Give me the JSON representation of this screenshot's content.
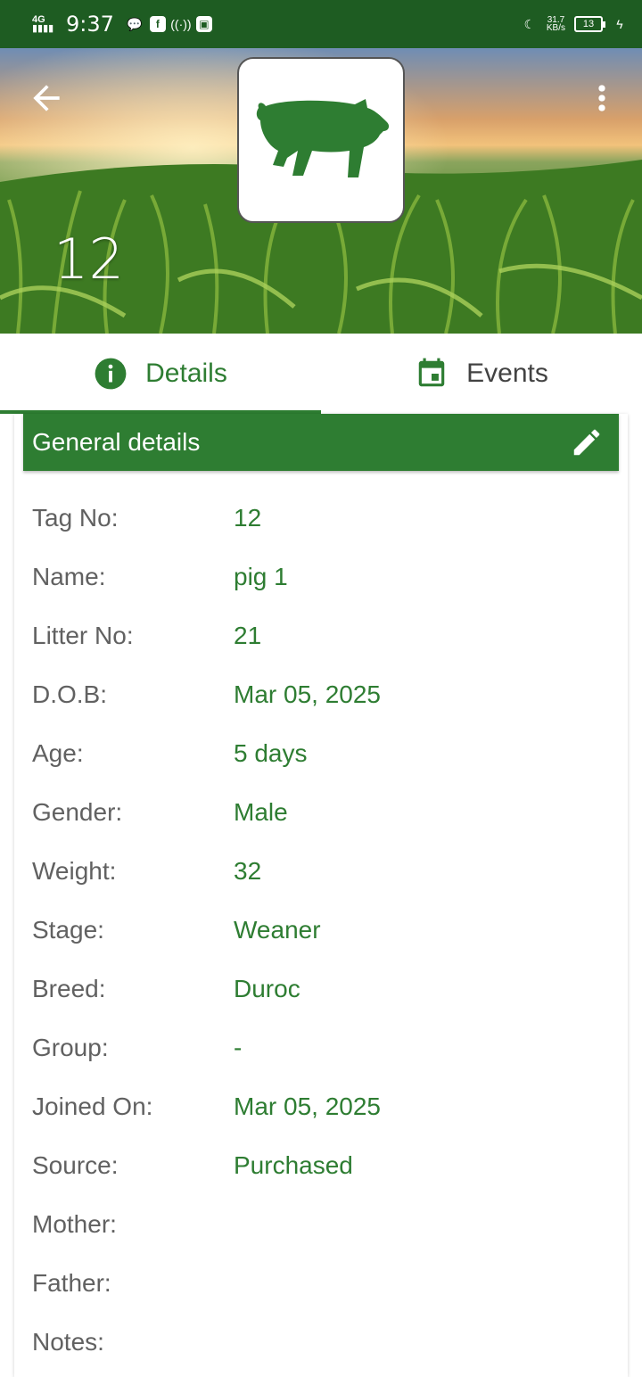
{
  "status_bar": {
    "network": "4G",
    "time": "9:37",
    "speed": "31.7\nKB/s",
    "battery": "13"
  },
  "header": {
    "animal_id": "12",
    "icons": {
      "back": "arrow-back-icon",
      "menu": "more-vertical-icon",
      "avatar": "pig-icon"
    }
  },
  "tabs": [
    {
      "label": "Details",
      "icon": "info-icon",
      "active": true
    },
    {
      "label": "Events",
      "icon": "calendar-icon",
      "active": false
    }
  ],
  "card": {
    "title": "General details",
    "rows": [
      {
        "label": "Tag No:",
        "value": "12"
      },
      {
        "label": "Name:",
        "value": "pig 1"
      },
      {
        "label": "Litter No:",
        "value": "21"
      },
      {
        "label": "D.O.B:",
        "value": "Mar 05, 2025"
      },
      {
        "label": "Age:",
        "value": "5 days"
      },
      {
        "label": "Gender:",
        "value": "Male"
      },
      {
        "label": "Weight:",
        "value": "32"
      },
      {
        "label": "Stage:",
        "value": "Weaner"
      },
      {
        "label": "Breed:",
        "value": "Duroc"
      },
      {
        "label": "Group:",
        "value": "-"
      },
      {
        "label": "Joined On:",
        "value": "Mar 05, 2025"
      },
      {
        "label": "Source:",
        "value": "Purchased"
      },
      {
        "label": "Mother:",
        "value": ""
      },
      {
        "label": "Father:",
        "value": ""
      },
      {
        "label": "Notes:",
        "value": ""
      }
    ]
  },
  "colors": {
    "primary": "#2e7d32",
    "status_bar": "#1e5c22",
    "label": "#616161"
  }
}
